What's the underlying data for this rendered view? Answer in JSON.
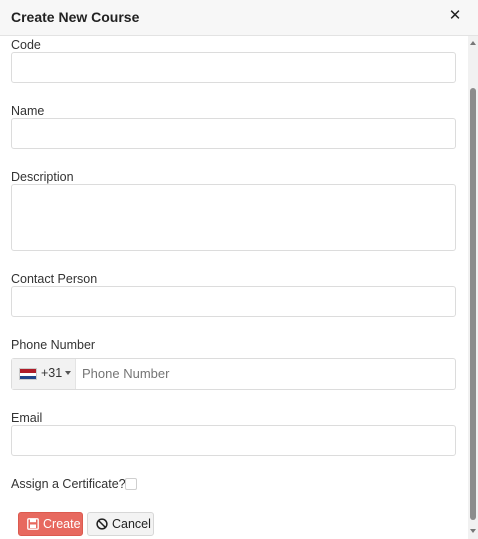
{
  "dialog": {
    "title": "Create New Course"
  },
  "fields": {
    "code_label": "Code",
    "name_label": "Name",
    "description_label": "Description",
    "contact_label": "Contact Person",
    "phone_label": "Phone Number",
    "phone_dial_code": "+31",
    "phone_placeholder": "Phone Number",
    "email_label": "Email",
    "certificate_label": "Assign a Certificate?"
  },
  "buttons": {
    "create": "Create",
    "cancel": "Cancel"
  },
  "colors": {
    "create_button": "#e7695f",
    "header_bg": "#f7f7f7"
  },
  "icons": {
    "close": "close-icon",
    "create": "save-icon",
    "cancel": "cancel-icon",
    "flag": "netherlands-flag-icon"
  }
}
